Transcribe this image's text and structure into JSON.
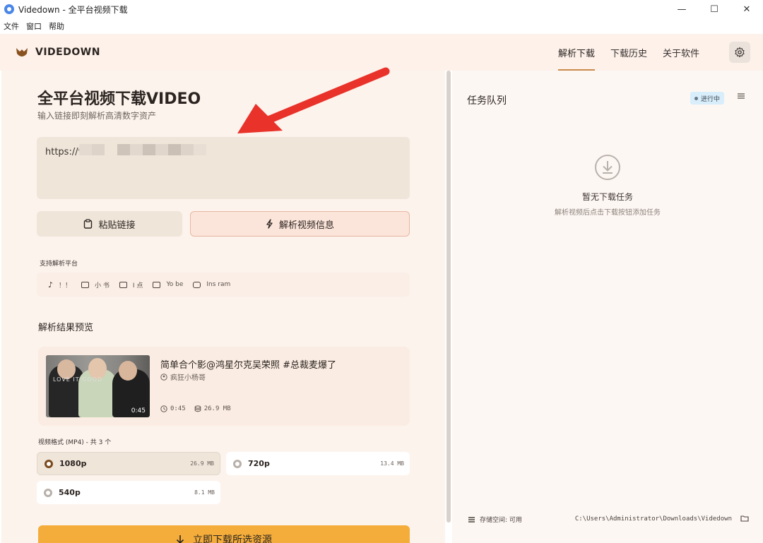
{
  "window": {
    "title": "Videdown - 全平台视频下载",
    "minimize": "—",
    "maximize": "☐",
    "close": "✕"
  },
  "menubar": [
    "文件",
    "窗口",
    "帮助"
  ],
  "header": {
    "brand": "VIDEDOWN",
    "nav": [
      "解析下载",
      "下载历史",
      "关于软件"
    ],
    "active_tab": 0
  },
  "main": {
    "title": "全平台视频下载VIDEO",
    "subtitle": "输入链接即刻解析高清数字资产",
    "url_value": "https://v.",
    "paste_label": "粘贴链接",
    "parse_label": "解析视频信息",
    "platforms_label": "支持解析平台",
    "platforms": [
      "！！",
      "小 书",
      "I 点",
      "Yo be",
      "Ins ram"
    ],
    "preview_label": "解析结果预览",
    "video": {
      "title": "简单合个影@鸿星尔克吴荣照 #总裁麦爆了",
      "author": "疯狂小杨哥",
      "duration": "0:45",
      "size": "26.9 MB",
      "thumb_duration": "0:45",
      "thumb_text": "LOVE IT GOOD"
    },
    "formats_label": "视频格式 (MP4) - 共 3 个",
    "formats": [
      {
        "name": "1080p",
        "size": "26.9 MB",
        "selected": true
      },
      {
        "name": "720p",
        "size": "13.4 MB",
        "selected": false
      },
      {
        "name": "540p",
        "size": "8.1 MB",
        "selected": false
      }
    ],
    "download_label": "立即下载所选资源"
  },
  "queue": {
    "title": "任务队列",
    "status": "进行中",
    "empty_title": "暂无下载任务",
    "empty_sub": "解析视频后点击下载按钮添加任务",
    "storage": "存储空间: 可用",
    "path": "C:\\Users\\Administrator\\Downloads\\Videdown"
  },
  "colors": {
    "accent": "#f4ad3a",
    "brand_brown": "#7a4a1e",
    "header_bg": "#fdf1ea",
    "annotation_red": "#e8322a"
  },
  "icons": {
    "paste": "clipboard-icon",
    "parse": "lightning-icon",
    "settings": "gear-icon",
    "empty": "download-circle-icon",
    "download": "arrow-down-icon"
  }
}
